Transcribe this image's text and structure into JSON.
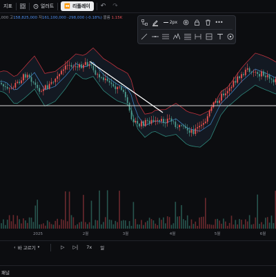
{
  "topbar": {
    "indicators_label": "지표",
    "alerts_label": "얼러트",
    "replay_label": "리플레이"
  },
  "ohlc": {
    "open_fragment": ",000",
    "high_label": "고",
    "high_value": "158,825,000",
    "low_label": "저",
    "low_value": "161,100,000",
    "change_value": "-298,000 (-0.18%)",
    "volume_label": "볼륨",
    "volume_value": "1.15K"
  },
  "drawing_toolbar": {
    "line_width_label": "2px"
  },
  "x_axis": {
    "labels": [
      "2025",
      "2월",
      "3월",
      "4월",
      "5월",
      "6월"
    ]
  },
  "timeframe_bar": {
    "goto_label": "바 고르기",
    "speed_label": "7x",
    "period_label": "일"
  },
  "bottom_panel": {
    "tab_label": "패널"
  },
  "colors": {
    "background": "#0c0d10",
    "up_candle": "#ef5350",
    "down_candle": "#4c9b8e",
    "band_line": "#c0323d",
    "band_mid": "#3d82c2",
    "horizontal_line": "#d7d7d7",
    "trend_line": "#ffffff"
  }
}
